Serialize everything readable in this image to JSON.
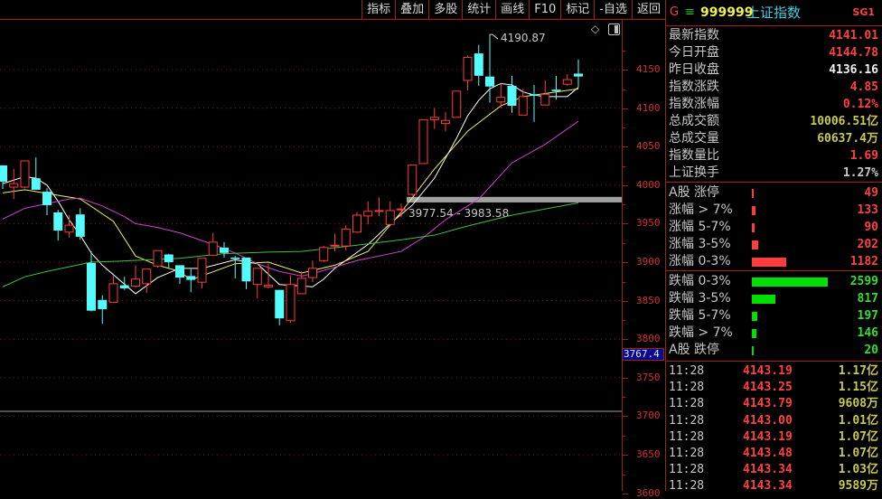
{
  "toolbar": {
    "buttons": [
      "指标",
      "叠加",
      "多股",
      "统计",
      "画线",
      "F10",
      "标记",
      "-自选",
      "返回"
    ]
  },
  "chart_data": {
    "type": "candlestick",
    "yticks": [
      4150,
      4100,
      4050,
      4000,
      3950,
      3900,
      3850,
      3800,
      3750,
      3700,
      3650,
      3600
    ],
    "ylim": [
      3600,
      4210
    ],
    "cursor_value": "3767.4",
    "high_marker": {
      "index": 44,
      "label": "4190.87"
    },
    "range_band": {
      "low": 3977.54,
      "high": 3983.58,
      "label": "3977.54 - 3983.58"
    },
    "ohlc": [
      [
        4025.6,
        4026,
        3995,
        4004.5
      ],
      [
        3997.4,
        4021,
        3982,
        4002
      ],
      [
        3997.4,
        4031.5,
        3996,
        4031.5
      ],
      [
        4009,
        4036,
        3994,
        3994
      ],
      [
        3991.5,
        3996,
        3961,
        3974
      ],
      [
        3964.6,
        3968,
        3928,
        3941
      ],
      [
        3939,
        3961,
        3932,
        3948
      ],
      [
        3962,
        3970,
        3929,
        3933
      ],
      [
        3899,
        3914,
        3836,
        3837
      ],
      [
        3851,
        3857,
        3820,
        3839
      ],
      [
        3848,
        3882,
        3847,
        3872
      ],
      [
        3870,
        3881,
        3864,
        3866
      ],
      [
        3869,
        3896,
        3867,
        3878
      ],
      [
        3872,
        3891,
        3860,
        3891
      ],
      [
        3895,
        3915,
        3893,
        3915
      ],
      [
        3910,
        3911,
        3893,
        3900
      ],
      [
        3896,
        3896,
        3872,
        3880
      ],
      [
        3882,
        3891,
        3861,
        3877
      ],
      [
        3874,
        3905,
        3866,
        3905
      ],
      [
        3909,
        3938,
        3909,
        3926
      ],
      [
        3919,
        3926,
        3906,
        3912
      ],
      [
        3906,
        3908,
        3879,
        3904
      ],
      [
        3906,
        3906,
        3865,
        3875
      ],
      [
        3871,
        3892,
        3853,
        3892
      ],
      [
        3868,
        3898,
        3866,
        3870
      ],
      [
        3864,
        3864,
        3818,
        3827
      ],
      [
        3824,
        3883,
        3821,
        3871
      ],
      [
        3859,
        3888,
        3859,
        3879
      ],
      [
        3880,
        3902,
        3874,
        3892
      ],
      [
        3902,
        3921,
        3900,
        3919
      ],
      [
        3921,
        3937,
        3914,
        3922
      ],
      [
        3921,
        3948,
        3915,
        3943
      ],
      [
        3939,
        3965,
        3938,
        3961
      ],
      [
        3960,
        3979,
        3949,
        3966
      ],
      [
        3966,
        3984,
        3960,
        3967
      ],
      [
        3949,
        3979,
        3949,
        3967
      ],
      [
        3968,
        3976,
        3958,
        3969
      ],
      [
        3988,
        4026,
        3986,
        4026
      ],
      [
        4028,
        4085,
        4028,
        4085
      ],
      [
        4085,
        4100,
        4073,
        4088
      ],
      [
        4080,
        4095,
        4070,
        4084
      ],
      [
        4088,
        4122,
        4088,
        4122
      ],
      [
        4136,
        4168,
        4123,
        4166
      ],
      [
        4171,
        4182,
        4129,
        4142
      ],
      [
        4141,
        4190.87,
        4107,
        4128
      ],
      [
        4108,
        4132,
        4100,
        4114
      ],
      [
        4129,
        4142,
        4094,
        4103
      ],
      [
        4091,
        4125,
        4091,
        4115
      ],
      [
        4118,
        4130,
        4082,
        4116
      ],
      [
        4104,
        4136,
        4104,
        4118
      ],
      [
        4124,
        4142,
        4111,
        4122
      ],
      [
        4131,
        4144,
        4129,
        4137
      ],
      [
        4144.78,
        4163,
        4127,
        4141.01
      ]
    ],
    "ma": [
      {
        "name": "MA5",
        "color": "#ffffff",
        "points": [
          [
            0,
            4002
          ],
          [
            2,
            4011
          ],
          [
            3,
            4009
          ],
          [
            4,
            4000
          ],
          [
            5,
            3979
          ],
          [
            6,
            3955
          ],
          [
            7,
            3935
          ],
          [
            8,
            3912
          ],
          [
            9,
            3896
          ],
          [
            12,
            3859
          ],
          [
            14,
            3880
          ],
          [
            16,
            3892
          ],
          [
            18,
            3892
          ],
          [
            21,
            3903
          ],
          [
            23,
            3898
          ],
          [
            25,
            3871
          ],
          [
            28,
            3868
          ],
          [
            29,
            3878
          ],
          [
            30,
            3892
          ],
          [
            33,
            3923
          ],
          [
            35,
            3950
          ],
          [
            37,
            3974
          ],
          [
            39,
            4009
          ],
          [
            41,
            4061
          ],
          [
            42,
            4090
          ],
          [
            43,
            4110
          ],
          [
            44,
            4125
          ],
          [
            45,
            4132
          ],
          [
            46,
            4130
          ],
          [
            47,
            4121
          ],
          [
            48,
            4117
          ],
          [
            49,
            4115
          ],
          [
            51,
            4115
          ],
          [
            52,
            4127
          ]
        ]
      },
      {
        "name": "MA10",
        "color": "#f0f060",
        "points": [
          [
            0,
            3990
          ],
          [
            2,
            3994
          ],
          [
            7,
            3982
          ],
          [
            10,
            3953
          ],
          [
            12,
            3908
          ],
          [
            14,
            3896
          ],
          [
            16,
            3888
          ],
          [
            17,
            3877
          ],
          [
            21,
            3898
          ],
          [
            24,
            3900
          ],
          [
            27,
            3886
          ],
          [
            30,
            3896
          ],
          [
            33,
            3914
          ],
          [
            36,
            3965
          ],
          [
            39,
            4021
          ],
          [
            42,
            4070
          ],
          [
            45,
            4103
          ],
          [
            47,
            4115
          ],
          [
            52,
            4125
          ]
        ]
      },
      {
        "name": "MA20",
        "color": "#d040d0",
        "points": [
          [
            0,
            3956
          ],
          [
            2,
            3970
          ],
          [
            4,
            3976
          ],
          [
            6,
            3982
          ],
          [
            7,
            3983
          ],
          [
            9,
            3973
          ],
          [
            11,
            3959
          ],
          [
            12,
            3950
          ],
          [
            14,
            3945
          ],
          [
            16,
            3938
          ],
          [
            18,
            3928
          ],
          [
            19,
            3923
          ],
          [
            21,
            3912
          ],
          [
            23,
            3898
          ],
          [
            25,
            3888
          ],
          [
            27,
            3882
          ],
          [
            28,
            3885
          ],
          [
            32,
            3902
          ],
          [
            36,
            3914
          ],
          [
            38,
            3932
          ],
          [
            40,
            3955
          ],
          [
            43,
            3982
          ],
          [
            46,
            4029
          ],
          [
            49,
            4053
          ],
          [
            52,
            4083
          ]
        ]
      },
      {
        "name": "MA60",
        "color": "#40c040",
        "points": [
          [
            0,
            3868
          ],
          [
            2,
            3881
          ],
          [
            4,
            3888
          ],
          [
            6,
            3894
          ],
          [
            8,
            3900
          ],
          [
            10,
            3901
          ],
          [
            16,
            3905
          ],
          [
            18,
            3908
          ],
          [
            20,
            3911
          ],
          [
            22,
            3912
          ],
          [
            24,
            3913
          ],
          [
            27,
            3914
          ],
          [
            32,
            3922
          ],
          [
            36,
            3929
          ],
          [
            39,
            3935
          ],
          [
            42,
            3947
          ],
          [
            46,
            3961
          ],
          [
            52,
            3977
          ]
        ]
      }
    ]
  },
  "panel": {
    "header": {
      "g": "G",
      "menu_icon": "≡",
      "code": "999999",
      "name": "上证指数",
      "badge": "SG1"
    },
    "quotes": [
      {
        "label": "最新指数",
        "value": "4141.01",
        "color": "red"
      },
      {
        "label": "今日开盘",
        "value": "4144.78",
        "color": "red"
      },
      {
        "label": "昨日收盘",
        "value": "4136.16",
        "color": "white"
      },
      {
        "label": "指数涨跌",
        "value": "4.85",
        "color": "red"
      },
      {
        "label": "指数涨幅",
        "value": "0.12%",
        "color": "red"
      },
      {
        "label": "总成交额",
        "value": "10006.51亿",
        "color": "yellow"
      },
      {
        "label": "总成交量",
        "value": "60637.4万",
        "color": "yellow"
      },
      {
        "label": "指数量比",
        "value": "1.69",
        "color": "red"
      },
      {
        "label": "上证换手",
        "value": "1.27%",
        "color": "gray"
      }
    ],
    "up": [
      {
        "label": "A股 涨停",
        "value": 49
      },
      {
        "label": "涨幅 > 7%",
        "value": 133
      },
      {
        "label": "涨幅 5-7%",
        "value": 90
      },
      {
        "label": "涨幅 3-5%",
        "value": 202
      },
      {
        "label": "涨幅 0-3%",
        "value": 1182
      }
    ],
    "down": [
      {
        "label": "跌幅 0-3%",
        "value": 2599
      },
      {
        "label": "跌幅 3-5%",
        "value": 817
      },
      {
        "label": "跌幅 5-7%",
        "value": 197
      },
      {
        "label": "跌幅 > 7%",
        "value": 146
      },
      {
        "label": "A股 跌停",
        "value": 20
      }
    ],
    "ticks": [
      {
        "time": "11:28",
        "price": "4143.19",
        "amount": "1.17亿"
      },
      {
        "time": "11:28",
        "price": "4143.25",
        "amount": "1.15亿"
      },
      {
        "time": "11:28",
        "price": "4143.79",
        "amount": "9608万"
      },
      {
        "time": "11:28",
        "price": "4143.00",
        "amount": "1.01亿"
      },
      {
        "time": "11:28",
        "price": "4143.19",
        "amount": "1.07亿"
      },
      {
        "time": "11:28",
        "price": "4143.48",
        "amount": "1.07亿"
      },
      {
        "time": "11:28",
        "price": "4143.34",
        "amount": "1.03亿"
      },
      {
        "time": "11:28",
        "price": "4143.34",
        "amount": "9589万"
      }
    ],
    "colors": {
      "red": "#ff4040",
      "green": "#00e000",
      "cyan": "#54fcfc"
    }
  }
}
